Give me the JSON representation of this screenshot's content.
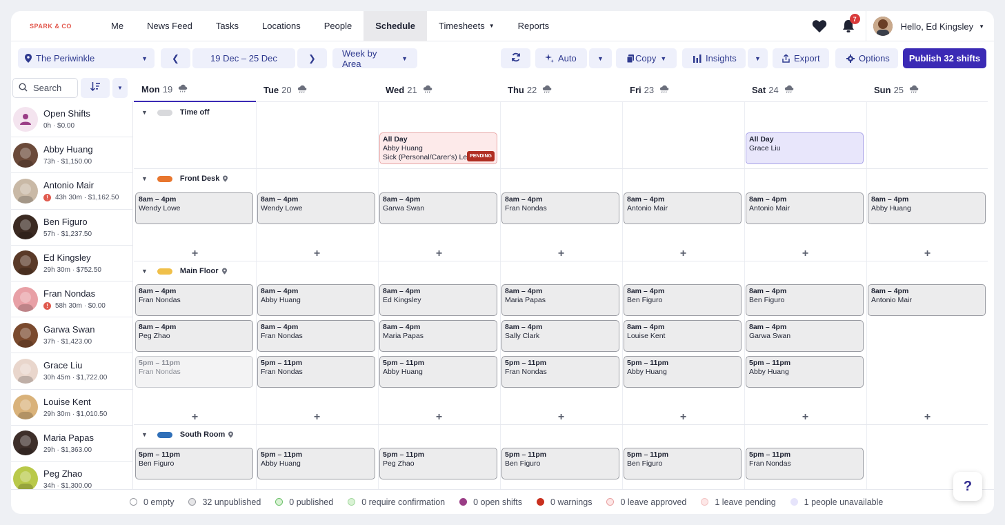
{
  "brand": "SPARK & CO",
  "nav": {
    "items": [
      {
        "label": "Me"
      },
      {
        "label": "News Feed"
      },
      {
        "label": "Tasks"
      },
      {
        "label": "Locations"
      },
      {
        "label": "People"
      },
      {
        "label": "Schedule",
        "active": true
      },
      {
        "label": "Timesheets",
        "dropdown": true
      },
      {
        "label": "Reports"
      }
    ],
    "notifications": "7",
    "greeting": "Hello, Ed Kingsley"
  },
  "toolbar": {
    "location": "The Periwinkle",
    "date_range": "19 Dec – 25 Dec",
    "view": "Week by Area",
    "auto": "Auto",
    "copy": "Copy",
    "insights": "Insights",
    "export": "Export",
    "options": "Options",
    "publish": "Publish 32 shifts"
  },
  "search": {
    "placeholder": "Search"
  },
  "days": [
    {
      "name": "Mon",
      "date": "19"
    },
    {
      "name": "Tue",
      "date": "20"
    },
    {
      "name": "Wed",
      "date": "21"
    },
    {
      "name": "Thu",
      "date": "22"
    },
    {
      "name": "Fri",
      "date": "23"
    },
    {
      "name": "Sat",
      "date": "24"
    },
    {
      "name": "Sun",
      "date": "25"
    }
  ],
  "people": [
    {
      "name": "Open Shifts",
      "meta": "0h · $0.00",
      "warn": false,
      "color": "#f4e4ef"
    },
    {
      "name": "Abby Huang",
      "meta": "73h · $1,150.00",
      "warn": false,
      "color": "#6b4a3a"
    },
    {
      "name": "Antonio Mair",
      "meta": "43h 30m · $1,162.50",
      "warn": true,
      "color": "#c9b9a6"
    },
    {
      "name": "Ben Figuro",
      "meta": "57h · $1,237.50",
      "warn": false,
      "color": "#3b2a22"
    },
    {
      "name": "Ed Kingsley",
      "meta": "29h 30m · $752.50",
      "warn": false,
      "color": "#5a3a28"
    },
    {
      "name": "Fran Nondas",
      "meta": "58h 30m · $0.00",
      "warn": true,
      "color": "#e8a0a6"
    },
    {
      "name": "Garwa Swan",
      "meta": "37h · $1,423.00",
      "warn": false,
      "color": "#7a4a2e"
    },
    {
      "name": "Grace Liu",
      "meta": "30h 45m · $1,722.00",
      "warn": false,
      "color": "#e9d6cc"
    },
    {
      "name": "Louise Kent",
      "meta": "29h 30m · $1,010.50",
      "warn": false,
      "color": "#d9b27a"
    },
    {
      "name": "Maria Papas",
      "meta": "29h · $1,363.00",
      "warn": false,
      "color": "#3e2f2a"
    },
    {
      "name": "Peg Zhao",
      "meta": "34h · $1,300.00",
      "warn": false,
      "color": "#b9c94a"
    }
  ],
  "areas": {
    "time_off": {
      "label": "Time off",
      "color": "#d8d9dc"
    },
    "front_desk": {
      "label": "Front Desk",
      "color": "#e8762e"
    },
    "main_floor": {
      "label": "Main Floor",
      "color": "#f0c04a"
    },
    "south_room": {
      "label": "South Room",
      "color": "#2f6fb8"
    }
  },
  "time_off": [
    {
      "day": 2,
      "title": "All Day",
      "name": "Abby Huang",
      "detail": "Sick (Personal/Carer's) Leave",
      "badge": "PENDING",
      "bg": "#fdeaea",
      "border": "#e8a7a7"
    },
    {
      "day": 5,
      "title": "All Day",
      "name": "Grace Liu",
      "bg": "#e8e6fb",
      "border": "#a9a3e8"
    }
  ],
  "front_desk": [
    {
      "day": 0,
      "row": 0,
      "time": "8am – 4pm",
      "name": "Wendy Lowe"
    },
    {
      "day": 1,
      "row": 0,
      "time": "8am – 4pm",
      "name": "Wendy Lowe"
    },
    {
      "day": 2,
      "row": 0,
      "time": "8am – 4pm",
      "name": "Garwa Swan"
    },
    {
      "day": 3,
      "row": 0,
      "time": "8am – 4pm",
      "name": "Fran Nondas"
    },
    {
      "day": 4,
      "row": 0,
      "time": "8am – 4pm",
      "name": "Antonio Mair"
    },
    {
      "day": 5,
      "row": 0,
      "time": "8am – 4pm",
      "name": "Antonio Mair"
    },
    {
      "day": 6,
      "row": 0,
      "time": "8am – 4pm",
      "name": "Abby Huang"
    }
  ],
  "main_floor": [
    {
      "day": 0,
      "row": 0,
      "time": "8am – 4pm",
      "name": "Fran Nondas"
    },
    {
      "day": 0,
      "row": 1,
      "time": "8am – 4pm",
      "name": "Peg Zhao"
    },
    {
      "day": 0,
      "row": 2,
      "time": "5pm – 11pm",
      "name": "Fran Nondas",
      "faded": true
    },
    {
      "day": 1,
      "row": 0,
      "time": "8am – 4pm",
      "name": "Abby Huang"
    },
    {
      "day": 1,
      "row": 1,
      "time": "8am – 4pm",
      "name": "Fran Nondas"
    },
    {
      "day": 1,
      "row": 2,
      "time": "5pm – 11pm",
      "name": "Fran Nondas"
    },
    {
      "day": 2,
      "row": 0,
      "time": "8am – 4pm",
      "name": "Ed Kingsley"
    },
    {
      "day": 2,
      "row": 1,
      "time": "8am – 4pm",
      "name": "Maria Papas"
    },
    {
      "day": 2,
      "row": 2,
      "time": "5pm – 11pm",
      "name": "Abby Huang"
    },
    {
      "day": 3,
      "row": 0,
      "time": "8am – 4pm",
      "name": "Maria Papas"
    },
    {
      "day": 3,
      "row": 1,
      "time": "8am – 4pm",
      "name": "Sally Clark"
    },
    {
      "day": 3,
      "row": 2,
      "time": "5pm – 11pm",
      "name": "Fran Nondas"
    },
    {
      "day": 4,
      "row": 0,
      "time": "8am – 4pm",
      "name": "Ben Figuro"
    },
    {
      "day": 4,
      "row": 1,
      "time": "8am – 4pm",
      "name": "Louise Kent"
    },
    {
      "day": 4,
      "row": 2,
      "time": "5pm – 11pm",
      "name": "Abby Huang"
    },
    {
      "day": 5,
      "row": 0,
      "time": "8am – 4pm",
      "name": "Ben Figuro"
    },
    {
      "day": 5,
      "row": 1,
      "time": "8am – 4pm",
      "name": "Garwa Swan"
    },
    {
      "day": 5,
      "row": 2,
      "time": "5pm – 11pm",
      "name": "Abby Huang"
    },
    {
      "day": 6,
      "row": 0,
      "time": "8am – 4pm",
      "name": "Antonio Mair"
    }
  ],
  "south_room": [
    {
      "day": 0,
      "row": 0,
      "time": "5pm – 11pm",
      "name": "Ben Figuro"
    },
    {
      "day": 1,
      "row": 0,
      "time": "5pm – 11pm",
      "name": "Abby Huang"
    },
    {
      "day": 2,
      "row": 0,
      "time": "5pm – 11pm",
      "name": "Peg Zhao"
    },
    {
      "day": 3,
      "row": 0,
      "time": "5pm – 11pm",
      "name": "Ben Figuro"
    },
    {
      "day": 4,
      "row": 0,
      "time": "5pm – 11pm",
      "name": "Ben Figuro"
    },
    {
      "day": 5,
      "row": 0,
      "time": "5pm – 11pm",
      "name": "Fran Nondas"
    }
  ],
  "legend": [
    {
      "label": "0 empty",
      "fill": "#ffffff",
      "border": "#9a9ca3"
    },
    {
      "label": "32 unpublished",
      "fill": "#e6e6e8",
      "border": "#9a9ca3"
    },
    {
      "label": "0 published",
      "fill": "#d9f2d4",
      "border": "#6cc06a"
    },
    {
      "label": "0 require confirmation",
      "fill": "#d9f2d4",
      "border": "#a5d9a1"
    },
    {
      "label": "0 open shifts",
      "fill": "#9a3d86",
      "border": "#9a3d86"
    },
    {
      "label": "0 warnings",
      "fill": "#c9301f",
      "border": "#c9301f"
    },
    {
      "label": "0 leave approved",
      "fill": "#fde7e7",
      "border": "#e8a0a0"
    },
    {
      "label": "1 leave pending",
      "fill": "#fde7e7",
      "border": "#f2c4c4"
    },
    {
      "label": "1 people unavailable",
      "fill": "#e6e4fb",
      "border": "#e6e4fb"
    }
  ],
  "help": "?"
}
